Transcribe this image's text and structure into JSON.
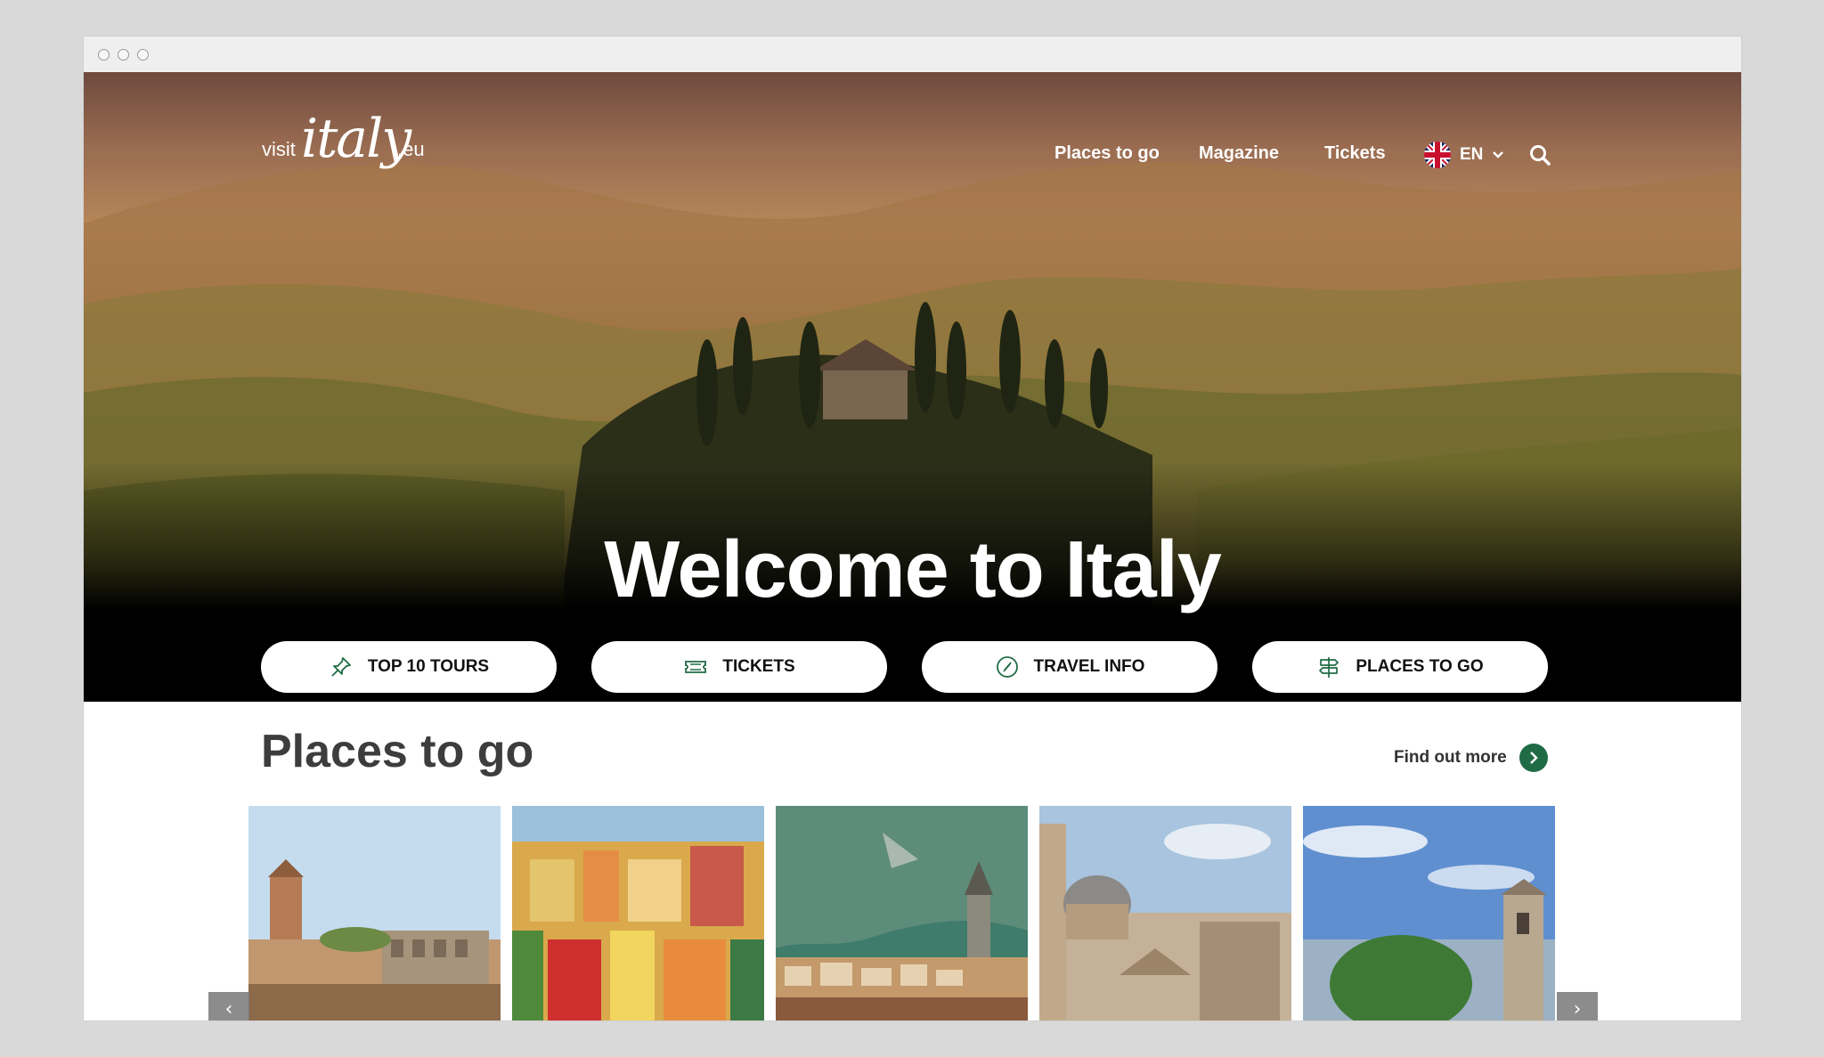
{
  "logo": {
    "visit": "visit",
    "italy": "italy",
    "eu": ".eu"
  },
  "nav": {
    "items": [
      {
        "label": "Places to go"
      },
      {
        "label": "Magazine"
      },
      {
        "label": "Tickets"
      }
    ],
    "language": "EN"
  },
  "hero": {
    "title": "Welcome to Italy",
    "buttons": [
      {
        "label": "TOP 10 TOURS",
        "icon": "pin-icon"
      },
      {
        "label": "TICKETS",
        "icon": "ticket-icon"
      },
      {
        "label": "TRAVEL INFO",
        "icon": "compass-icon"
      },
      {
        "label": "PLACES TO GO",
        "icon": "signpost-icon"
      }
    ]
  },
  "places": {
    "title": "Places to go",
    "find_more": "Find out more"
  },
  "carousel": {
    "prev": "‹",
    "next": "›"
  },
  "colors": {
    "accent_green": "#1f6b45",
    "heading": "#3d3d3d"
  }
}
